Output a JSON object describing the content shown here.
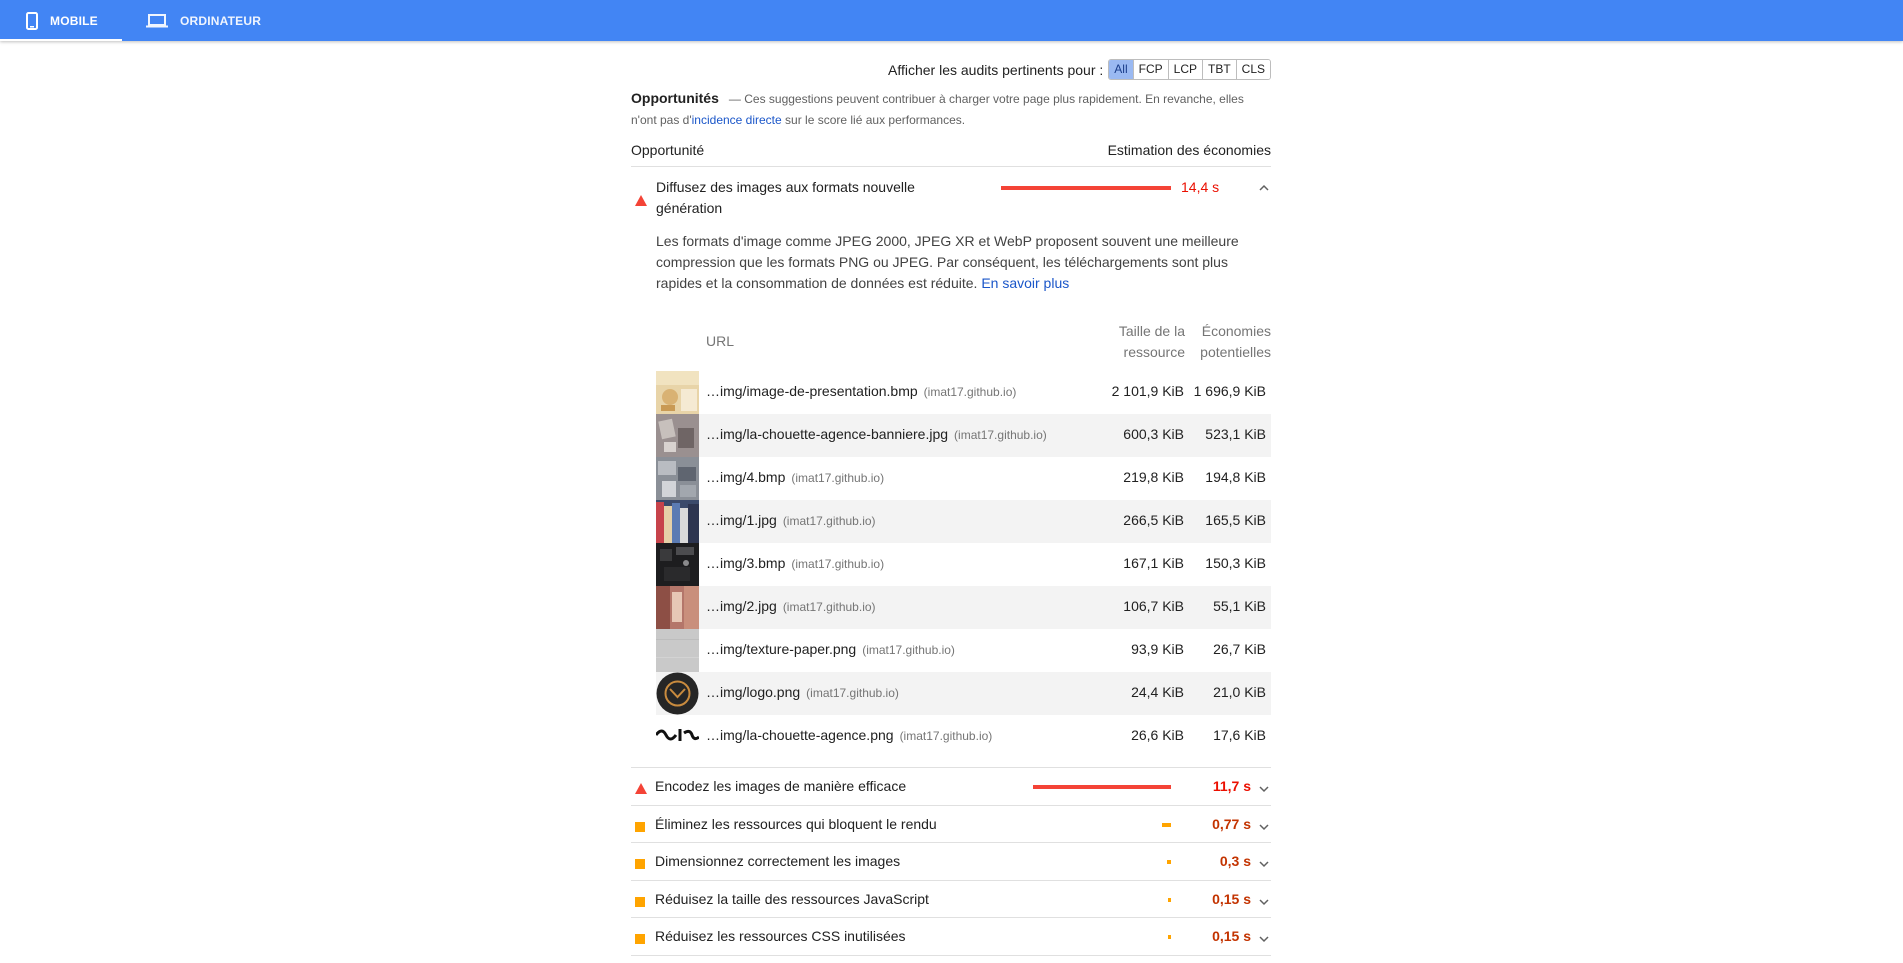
{
  "tabs": [
    {
      "label": "MOBILE",
      "icon": "phone-icon"
    },
    {
      "label": "ORDINATEUR",
      "icon": "laptop-icon"
    }
  ],
  "filters": {
    "label": "Afficher les audits pertinents pour :",
    "options": [
      "All",
      "FCP",
      "LCP",
      "TBT",
      "CLS"
    ],
    "active": "All"
  },
  "opportunities": {
    "title": "Opportunités",
    "desc_before": "— Ces suggestions peuvent contribuer à charger votre page plus rapidement. En revanche, elles n'ont pas d'",
    "desc_link": "incidence directe",
    "desc_after": " sur le score lié aux performances.",
    "col_opportunity": "Opportunité",
    "col_savings": "Estimation des économies"
  },
  "expanded": {
    "title": "Diffusez des images aux formats nouvelle génération",
    "value": "14,4 s",
    "bar_fraction": 1.0,
    "description": "Les formats d'image comme JPEG 2000, JPEG XR et WebP proposent souvent une meilleure compression que les formats PNG ou JPEG. Par conséquent, les téléchargements sont plus rapides et la consommation de données est réduite.",
    "learn_more": "En savoir plus",
    "table": {
      "col_url": "URL",
      "col_size_1": "Taille de la",
      "col_size_2": "ressource",
      "col_save_1": "Économies",
      "col_save_2": "potentielles",
      "rows": [
        {
          "url": "…img/image-de-presentation.bmp",
          "host": "(imat17.github.io)",
          "size": "2 101,9 KiB",
          "savings": "1 696,9 KiB"
        },
        {
          "url": "…img/la-chouette-agence-banniere.jpg",
          "host": "(imat17.github.io)",
          "size": "600,3 KiB",
          "savings": "523,1 KiB"
        },
        {
          "url": "…img/4.bmp",
          "host": "(imat17.github.io)",
          "size": "219,8 KiB",
          "savings": "194,8 KiB"
        },
        {
          "url": "…img/1.jpg",
          "host": "(imat17.github.io)",
          "size": "266,5 KiB",
          "savings": "165,5 KiB"
        },
        {
          "url": "…img/3.bmp",
          "host": "(imat17.github.io)",
          "size": "167,1 KiB",
          "savings": "150,3 KiB"
        },
        {
          "url": "…img/2.jpg",
          "host": "(imat17.github.io)",
          "size": "106,7 KiB",
          "savings": "55,1 KiB"
        },
        {
          "url": "…img/texture-paper.png",
          "host": "(imat17.github.io)",
          "size": "93,9 KiB",
          "savings": "26,7 KiB"
        },
        {
          "url": "…img/logo.png",
          "host": "(imat17.github.io)",
          "size": "24,4 KiB",
          "savings": "21,0 KiB"
        },
        {
          "url": "…img/la-chouette-agence.png",
          "host": "(imat17.github.io)",
          "size": "26,6 KiB",
          "savings": "17,6 KiB"
        }
      ]
    }
  },
  "audits": [
    {
      "title": "Encodez les images de manière efficace",
      "value": "11,7 s",
      "severity": "fail",
      "bar_fraction": 0.81
    },
    {
      "title": "Éliminez les ressources qui bloquent le rendu",
      "value": "0,77 s",
      "severity": "average",
      "bar_fraction": 0.053
    },
    {
      "title": "Dimensionnez correctement les images",
      "value": "0,3 s",
      "severity": "average",
      "bar_fraction": 0.021
    },
    {
      "title": "Réduisez la taille des ressources JavaScript",
      "value": "0,15 s",
      "severity": "average",
      "bar_fraction": 0.01
    },
    {
      "title": "Réduisez les ressources CSS inutilisées",
      "value": "0,15 s",
      "severity": "average",
      "bar_fraction": 0.01
    }
  ],
  "colors": {
    "header": "#4285f4",
    "fail": "#f44336",
    "fail_text": "#eb0f00",
    "average": "#ffa400",
    "average_text": "#c33300",
    "link": "#1a56c9"
  }
}
